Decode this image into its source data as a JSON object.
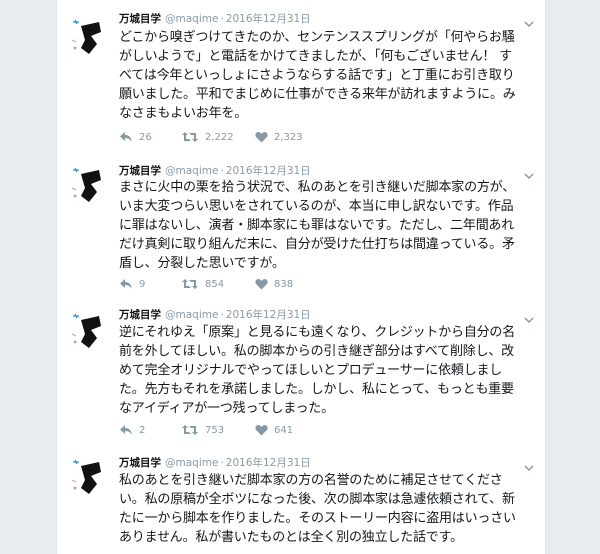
{
  "tweets": [
    {
      "name": "万城目学",
      "handle": "@maqime",
      "dot": "·",
      "time": "2016年12月31日",
      "lines": [
        "どこから嗅ぎつけてきたのか、センテンススプリングが「何やらお騒",
        "がしいようで」と電話をかけてきましたが、「何もございません！ す",
        "べては今年といっしょにさようならする話です」と丁重にお引き取り",
        "願いました。平和でまじめに仕事ができる来年が訪れますように。み",
        "なさまもよいお年を。"
      ],
      "replies": "26",
      "retweets": "2,222",
      "likes": "2,323"
    },
    {
      "name": "万城目学",
      "handle": "@maqime",
      "dot": "·",
      "time": "2016年12月31日",
      "lines": [
        "まさに火中の栗を拾う状況で、私のあとを引き継いだ脚本家の方が、",
        "いま大変つらい思いをされているのが、本当に申し訳ないです。作品",
        "に罪はないし、演者・脚本家にも罪はないです。ただし、二年間あれ",
        "だけ真剣に取り組んだ末に、自分が受けた仕打ちは間違っている。矛",
        "盾し、分裂した思いですが。"
      ],
      "replies": "9",
      "retweets": "854",
      "likes": "838"
    },
    {
      "name": "万城目学",
      "handle": "@maqime",
      "dot": "·",
      "time": "2016年12月31日",
      "lines": [
        "逆にそれゆえ「原案」と見るにも遠くなり、クレジットから自分の名",
        "前を外してほしい。私の脚本からの引き継ぎ部分はすべて削除し、改",
        "めて完全オリジナルでやってほしいとプロデューサーに依頼しまし",
        "た。先方もそれを承諾しました。しかし、私にとって、もっとも重要",
        "なアイディアが一つ残ってしまった。"
      ],
      "replies": "2",
      "retweets": "753",
      "likes": "641"
    },
    {
      "name": "万城目学",
      "handle": "@maqime",
      "dot": "·",
      "time": "2016年12月31日",
      "lines": [
        "私のあとを引き継いだ脚本家の方の名誉のために補足させてくださ",
        "い。私の原稿が全ボツになった後、次の脚本家は急遽依頼されて、新",
        "たに一から脚本を作りました。そのストーリー内容に盗用はいっさい",
        "ありません。私が書いたものとは全く別の独立した話です。"
      ],
      "replies": "",
      "retweets": "",
      "likes": ""
    }
  ],
  "colors": {
    "name": "#14171a",
    "meta": "#8899a6",
    "background": "#e6ecf0",
    "card": "#ffffff"
  },
  "icons": {
    "reply": "reply-icon",
    "retweet": "retweet-icon",
    "like": "heart-icon",
    "more": "chevron-down-icon"
  }
}
